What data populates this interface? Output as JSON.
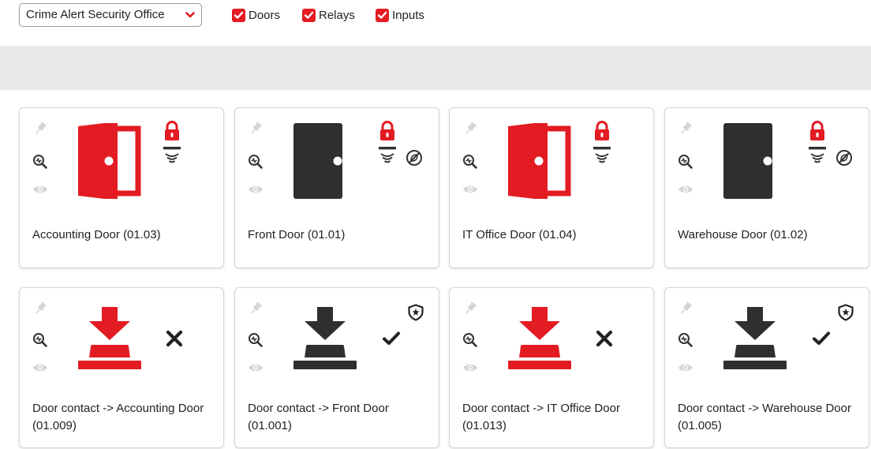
{
  "filters": {
    "site": "Crime Alert Security Office",
    "checkboxes": [
      {
        "label": "Doors",
        "checked": true
      },
      {
        "label": "Relays",
        "checked": true
      },
      {
        "label": "Inputs",
        "checked": true
      }
    ]
  },
  "doors": [
    {
      "name": "Accounting Door (01.03)",
      "state": "open",
      "locked": true,
      "alarm_disabled": false
    },
    {
      "name": "Front Door (01.01)",
      "state": "closed",
      "locked": true,
      "alarm_disabled": true
    },
    {
      "name": "IT Office Door (01.04)",
      "state": "open",
      "locked": true,
      "alarm_disabled": false
    },
    {
      "name": "Warehouse Door (01.02)",
      "state": "closed",
      "locked": true,
      "alarm_disabled": true
    }
  ],
  "inputs": [
    {
      "name": "Door contact -> Accounting Door (01.009)",
      "active": true,
      "status": "x",
      "armed_badge": false
    },
    {
      "name": "Door contact -> Front Door (01.001)",
      "active": false,
      "status": "check",
      "armed_badge": true
    },
    {
      "name": "Door contact -> IT Office Door (01.013)",
      "active": true,
      "status": "x",
      "armed_badge": false
    },
    {
      "name": "Door contact -> Warehouse Door (01.005)",
      "active": false,
      "status": "check",
      "armed_badge": true
    }
  ],
  "colors": {
    "accent": "#e31b23",
    "dark": "#2f2f2f",
    "muted": "#d4d4d4",
    "panel": "#e9e9e9"
  }
}
